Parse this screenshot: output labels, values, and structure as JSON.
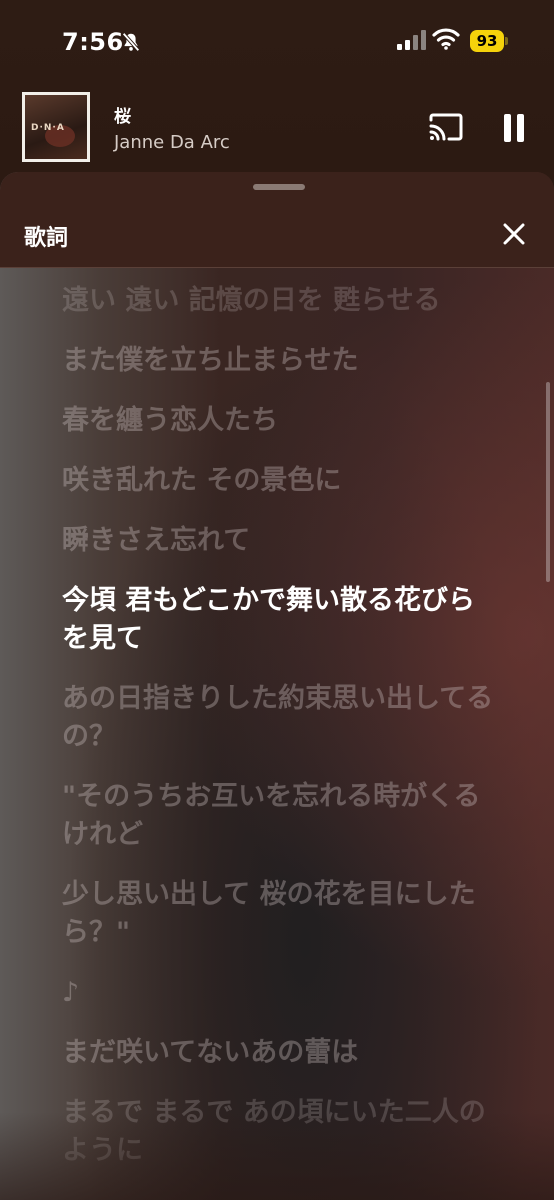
{
  "status_bar": {
    "time": "7:56",
    "battery": "93"
  },
  "now_playing": {
    "title": "桜",
    "artist": "Janne Da Arc",
    "art_text": "D·N·A"
  },
  "sheet": {
    "title": "歌詞"
  },
  "lyrics": [
    "遠い 遠い 記憶の日を 甦らせる",
    "また僕を立ち止まらせた",
    "春を纏う恋人たち",
    "咲き乱れた その景色に",
    "瞬きさえ忘れて",
    "今頃 君もどこかで舞い散る花びらを見て",
    "あの日指きりした約束思い出してるの？",
    "\"そのうちお互いを忘れる時がくるけれど",
    "少し思い出して 桜の花を目にしたら？\"",
    "♪",
    "まだ咲いてないあの蕾は",
    "まるで まるで あの頃にいた二人のように"
  ],
  "active_line_index": 5,
  "icons": {
    "mute": "bell-slash-icon",
    "signal": "cellular-signal-icon",
    "wifi": "wifi-icon",
    "cast": "cast-icon",
    "pause": "pause-icon",
    "close": "close-icon"
  },
  "colors": {
    "battery": "#f5d20b",
    "background": "#2a1a13"
  }
}
